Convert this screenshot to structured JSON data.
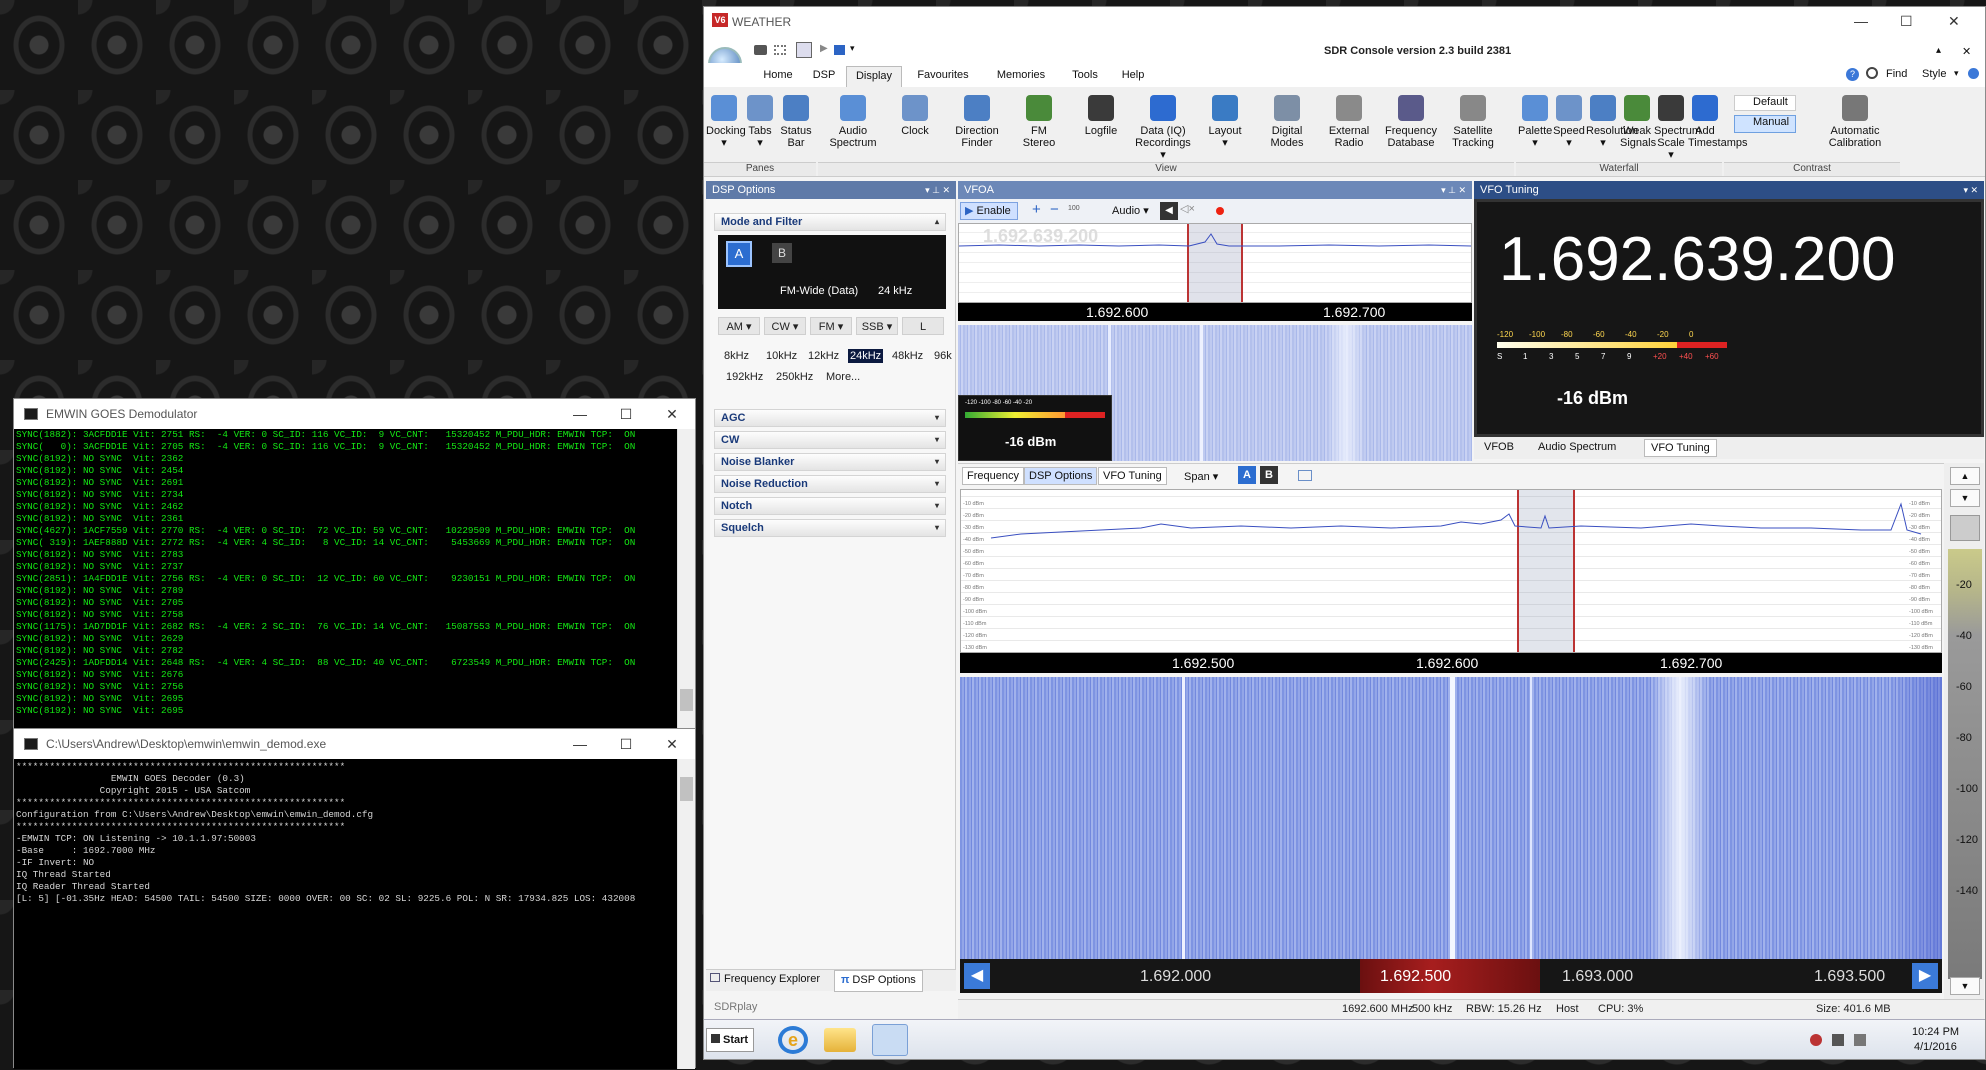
{
  "demod_window": {
    "title": "EMWIN GOES Demodulator",
    "lines": [
      "SYNC(1882): 3ACFDD1E Vit: 2751 RS:  -4 VER: 0 SC_ID: 116 VC_ID:  9 VC_CNT:   15320452 M_PDU_HDR: EMWIN TCP:  ON",
      "SYNC(   0): 3ACFDD1E Vit: 2705 RS:  -4 VER: 0 SC_ID: 116 VC_ID:  9 VC_CNT:   15320452 M_PDU_HDR: EMWIN TCP:  ON",
      "SYNC(8192): NO SYNC  Vit: 2362",
      "SYNC(8192): NO SYNC  Vit: 2454",
      "SYNC(8192): NO SYNC  Vit: 2691",
      "SYNC(8192): NO SYNC  Vit: 2734",
      "SYNC(8192): NO SYNC  Vit: 2462",
      "SYNC(8192): NO SYNC  Vit: 2361",
      "SYNC(4627): 1ACF7559 Vit: 2770 RS:  -4 VER: 0 SC_ID:  72 VC_ID: 59 VC_CNT:   10229509 M_PDU_HDR: EMWIN TCP:  ON",
      "SYNC( 319): 1AEF888D Vit: 2772 RS:  -4 VER: 4 SC_ID:   8 VC_ID: 14 VC_CNT:    5453669 M_PDU_HDR: EMWIN TCP:  ON",
      "SYNC(8192): NO SYNC  Vit: 2783",
      "SYNC(8192): NO SYNC  Vit: 2737",
      "SYNC(2851): 1A4FDD1E Vit: 2756 RS:  -4 VER: 0 SC_ID:  12 VC_ID: 60 VC_CNT:    9230151 M_PDU_HDR: EMWIN TCP:  ON",
      "SYNC(8192): NO SYNC  Vit: 2789",
      "SYNC(8192): NO SYNC  Vit: 2705",
      "SYNC(8192): NO SYNC  Vit: 2758",
      "SYNC(1175): 1AD7DD1F Vit: 2682 RS:  -4 VER: 2 SC_ID:  76 VC_ID: 14 VC_CNT:   15087553 M_PDU_HDR: EMWIN TCP:  ON",
      "SYNC(8192): NO SYNC  Vit: 2629",
      "SYNC(8192): NO SYNC  Vit: 2782",
      "SYNC(2425): 1ADFDD14 Vit: 2648 RS:  -4 VER: 4 SC_ID:  88 VC_ID: 40 VC_CNT:    6723549 M_PDU_HDR: EMWIN TCP:  ON",
      "SYNC(8192): NO SYNC  Vit: 2676",
      "SYNC(8192): NO SYNC  Vit: 2756",
      "SYNC(8192): NO SYNC  Vit: 2695",
      "SYNC(8192): NO SYNC  Vit: 2695"
    ]
  },
  "decoder_window": {
    "title": "C:\\Users\\Andrew\\Desktop\\emwin\\emwin_demod.exe",
    "lines": [
      "***********************************************************",
      "                 EMWIN GOES Decoder (0.3)",
      "               Copyright 2015 - USA Satcom",
      "***********************************************************",
      "Configuration from C:\\Users\\Andrew\\Desktop\\emwin\\emwin_demod.cfg",
      "***********************************************************",
      "-EMWIN TCP: ON Listening -> 10.1.1.97:50003",
      "-Base     : 1692.7000 MHz",
      "-IF Invert: NO",
      "IQ Thread Started",
      "IQ Reader Thread Started",
      "[L: 5] [-01.35Hz HEAD: 54500 TAIL: 54500 SIZE: 0000 OVER: 00 SC: 02 SL: 9225.6 POL: N SR: 17934.825 LOS: 432008"
    ]
  },
  "sdr": {
    "app_label": "WEATHER",
    "title": "SDR Console version 2.3 build 2381",
    "find": "Find",
    "style": "Style",
    "tabs": [
      "Home",
      "DSP",
      "Display",
      "Favourites",
      "Memories",
      "Tools",
      "Help"
    ],
    "ribbon": {
      "panes": [
        {
          "l1": "Docking",
          "l2": "▾"
        },
        {
          "l1": "Tabs",
          "l2": "▾"
        },
        {
          "l1": "Status",
          "l2": "Bar"
        }
      ],
      "view": [
        {
          "l1": "Audio",
          "l2": "Spectrum"
        },
        {
          "l1": "Clock",
          "l2": ""
        },
        {
          "l1": "Direction",
          "l2": "Finder"
        },
        {
          "l1": "FM",
          "l2": "Stereo"
        },
        {
          "l1": "Logfile",
          "l2": ""
        },
        {
          "l1": "Data (IQ)",
          "l2": "Recordings ▾"
        },
        {
          "l1": "Layout",
          "l2": "▾"
        },
        {
          "l1": "Digital",
          "l2": "Modes"
        },
        {
          "l1": "External",
          "l2": "Radio"
        },
        {
          "l1": "Frequency",
          "l2": "Database"
        },
        {
          "l1": "Satellite",
          "l2": "Tracking"
        }
      ],
      "waterfall": [
        {
          "l1": "Palette",
          "l2": "▾"
        },
        {
          "l1": "Speed",
          "l2": "▾"
        },
        {
          "l1": "Resolution",
          "l2": "▾"
        },
        {
          "l1": "Weak",
          "l2": "Signals"
        },
        {
          "l1": "Spectrum",
          "l2": "Scale ▾"
        },
        {
          "l1": "Add",
          "l2": "Timestamps"
        }
      ],
      "contrast": {
        "default": "Default",
        "manual": "Manual",
        "auto1": "Automatic",
        "auto2": "Calibration"
      },
      "groups": {
        "panes": "Panes",
        "view": "View",
        "waterfall": "Waterfall",
        "contrast": "Contrast"
      }
    },
    "dsp": {
      "header": "DSP Options",
      "mode_filter": "Mode and Filter",
      "vfo_a": "A",
      "vfo_b": "B",
      "mode_desc": "FM-Wide (Data)",
      "bandwidth": "24 kHz",
      "modes": [
        "AM ▾",
        "CW ▾",
        "FM ▾",
        "SSB ▾",
        "L"
      ],
      "bw1": [
        "8kHz",
        "10kHz",
        "12kHz",
        "24kHz",
        "48kHz",
        "96k"
      ],
      "bw2": [
        "192kHz",
        "250kHz",
        "More..."
      ],
      "sections": [
        "AGC",
        "CW",
        "Noise Blanker",
        "Noise Reduction",
        "Notch",
        "Squelch"
      ],
      "bottom_tabs": [
        "Frequency Explorer",
        "DSP Options"
      ],
      "footer": "SDRplay"
    },
    "vfoa": {
      "header": "VFOA",
      "enable": "Enable",
      "audio": "Audio ▾",
      "small_freq": "1.692.639.200",
      "scale": [
        "1.692.600",
        "1.692.700"
      ],
      "smeter_dbm": "-16 dBm",
      "meter_ticks": "-120 -100 -80 -60 -40 -20"
    },
    "vfo_tuning": {
      "header": "VFO Tuning",
      "freq": "1.692.639.200",
      "meter_top": [
        "-120",
        "-100",
        "-80",
        "-60",
        "-40",
        "-20",
        "0"
      ],
      "meter_bottom": [
        "S",
        "1",
        "3",
        "5",
        "7",
        "9",
        "+20",
        "+40",
        "+60"
      ],
      "dbm": "-16 dBm",
      "tabs": [
        "VFOB",
        "Audio Spectrum",
        "VFO Tuning"
      ]
    },
    "main": {
      "tabs": [
        "Frequency",
        "DSP Options",
        "VFO Tuning"
      ],
      "span": "Span ▾",
      "btn_a": "A",
      "btn_b": "B",
      "dbm_labels": [
        "-10 dBm",
        "-20 dBm",
        "-30 dBm",
        "-40 dBm",
        "-50 dBm",
        "-60 dBm",
        "-70 dBm",
        "-80 dBm",
        "-90 dBm",
        "-100 dBm",
        "-110 dBm",
        "-120 dBm",
        "-130 dBm"
      ],
      "scale": [
        "1.692.500",
        "1.692.600",
        "1.692.700"
      ],
      "right_scale": [
        "-20",
        "-40",
        "-60",
        "-80",
        "-100",
        "-120",
        "-140"
      ],
      "bottom_scale": [
        "1.692.000",
        "1.692.500",
        "1.693.000",
        "1.693.500"
      ]
    },
    "status": {
      "freq": "1692.600 MHz",
      "span": "500 kHz",
      "rbw": "RBW: 15.26 Hz",
      "host": "Host",
      "cpu": "CPU: 3%",
      "size": "Size: 401.6 MB"
    }
  },
  "taskbar": {
    "start": "Start",
    "time": "10:24 PM",
    "date": "4/1/2016"
  }
}
